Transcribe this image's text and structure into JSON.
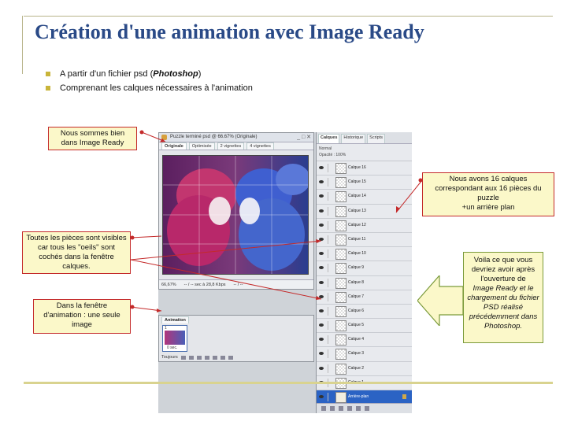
{
  "title": "Création d'une animation avec  Image Ready",
  "bullets": [
    {
      "prefix": "A partir d'un fichier psd (",
      "emph": "Photoshop",
      "suffix": ")"
    },
    {
      "text": "Comprenant les calques nécessaires à l'animation"
    }
  ],
  "callouts": {
    "image_ready": "Nous sommes  bien dans Image Ready",
    "pieces_visible": "Toutes les pièces sont visibles car tous les \"oeils\" sont cochés dans la fenêtre calques.",
    "animation_window": "Dans la fenêtre d'animation : une seule image",
    "layers_count": "Nous avons 16 calques correspondant aux 16 pièces du puzzle\n+un arrière plan"
  },
  "green_note": {
    "line1": "Voila ce que vous devriez avoir après l'ouverture de",
    "italic": "Image Ready et le chargement du fichier PSD réalisé précédemment dans Photoshop."
  },
  "screenshot": {
    "doc_title": "Puzzle terminé psd @ 66.67% (Originale)",
    "doc_tabs": [
      "Originale",
      "Optimisée",
      "2 vignettes",
      "4 vignettes"
    ],
    "status": [
      "66,67%",
      "-- / -- sec à 28,8 Kbps",
      "-- / --"
    ],
    "animation_tab": "Animation",
    "frame_number": "1",
    "frame_delay": "0 sec.",
    "loop": "Toujours",
    "layer_tabs": [
      "Calques",
      "Historique",
      "Scripts"
    ],
    "layer_mode": "Normal",
    "layer_opacity": "Opacité : 100%",
    "layers": [
      "Calque 16",
      "Calque 15",
      "Calque 14",
      "Calque 13",
      "Calque 12",
      "Calque 11",
      "Calque 10",
      "Calque 9",
      "Calque 8",
      "Calque 7",
      "Calque 6",
      "Calque 5",
      "Calque 4",
      "Calque 3",
      "Calque 2",
      "Calque 1",
      "Arrière-plan"
    ]
  },
  "colors": {
    "title": "#2a4a87",
    "callout_border": "#c42a2a",
    "callout_fill": "#fbf8c9",
    "arrow_green": "#7a9a3a",
    "bullet": "#c9b53a"
  }
}
